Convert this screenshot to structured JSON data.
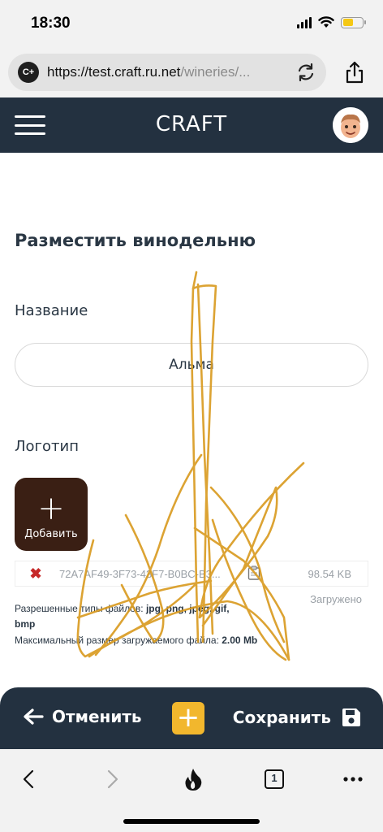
{
  "status_bar": {
    "time": "18:30"
  },
  "browser": {
    "url_host": "https://test.craft.ru.net",
    "url_path": "/wineries/...",
    "site_icon_text": "C+",
    "tab_count": "1"
  },
  "header": {
    "brand": "CRAFT"
  },
  "form": {
    "title": "Разместить винодельню",
    "name_label": "Название",
    "name_value": "Альма",
    "logo_label": "Логотип",
    "add_button_label": "Добавить",
    "file": {
      "name": "72A7AF49-3F73-43F7-B0BC-B3...",
      "size": "98.54 KB",
      "status": "Загружено"
    },
    "allowed_types_prefix": "Разрешенные типы файлов: ",
    "allowed_types": "jpg, png, jpeg, gif,",
    "allowed_types_cont": "bmp",
    "max_size_prefix": "Максимальный размер загружаемого файла: ",
    "max_size": "2.00 Mb"
  },
  "actions": {
    "cancel_label": "Отменить",
    "save_label": "Сохранить"
  },
  "colors": {
    "header_bg": "#233140",
    "accent": "#f2b72d",
    "add_button_bg": "#3a1f14",
    "scribble": "#d99a1e"
  },
  "icons": [
    "hamburger-icon",
    "reload-icon",
    "share-icon",
    "arrow-left-icon",
    "plus-icon",
    "save-icon",
    "back-icon",
    "forward-icon",
    "fire-icon",
    "tabs-icon",
    "more-icon"
  ]
}
